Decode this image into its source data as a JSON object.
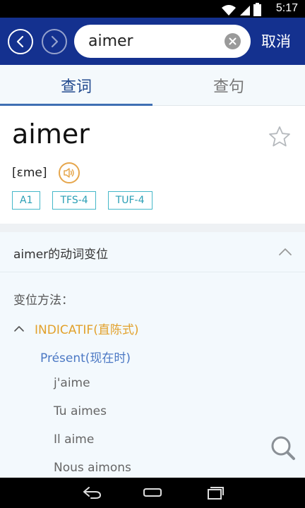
{
  "status_bar": {
    "time": "5:17",
    "icons": [
      "wifi-icon",
      "signal-icon",
      "battery-icon"
    ]
  },
  "topbar": {
    "back_icon": "chevron-left-icon",
    "forward_icon": "chevron-right-icon",
    "search_value": "aimer",
    "clear_icon": "clear-icon",
    "cancel_label": "取消",
    "color": "#14318f"
  },
  "tabs": [
    {
      "label": "查词",
      "active": true
    },
    {
      "label": "查句",
      "active": false
    }
  ],
  "entry": {
    "word": "aimer",
    "phonetic": "[ɛme]",
    "tags": [
      "A1",
      "TFS-4",
      "TUF-4"
    ],
    "favorite_icon": "star-icon",
    "audio_icon": "speaker-icon"
  },
  "conjugation": {
    "header": "aimer的动词变位",
    "method_label": "变位方法：",
    "mood": "INDICATIF(直陈式)",
    "tense": "Présent(现在时)",
    "forms": [
      "j'aime",
      "Tu aimes",
      "Il aime",
      "Nous aimons"
    ]
  },
  "fab_icon": "search-icon",
  "nav_bar": {
    "icons": [
      "back-icon",
      "home-icon",
      "recents-icon"
    ]
  },
  "colors": {
    "accent": "#e2a12b",
    "tense": "#4b78c4",
    "tag": "#45b8c9"
  }
}
